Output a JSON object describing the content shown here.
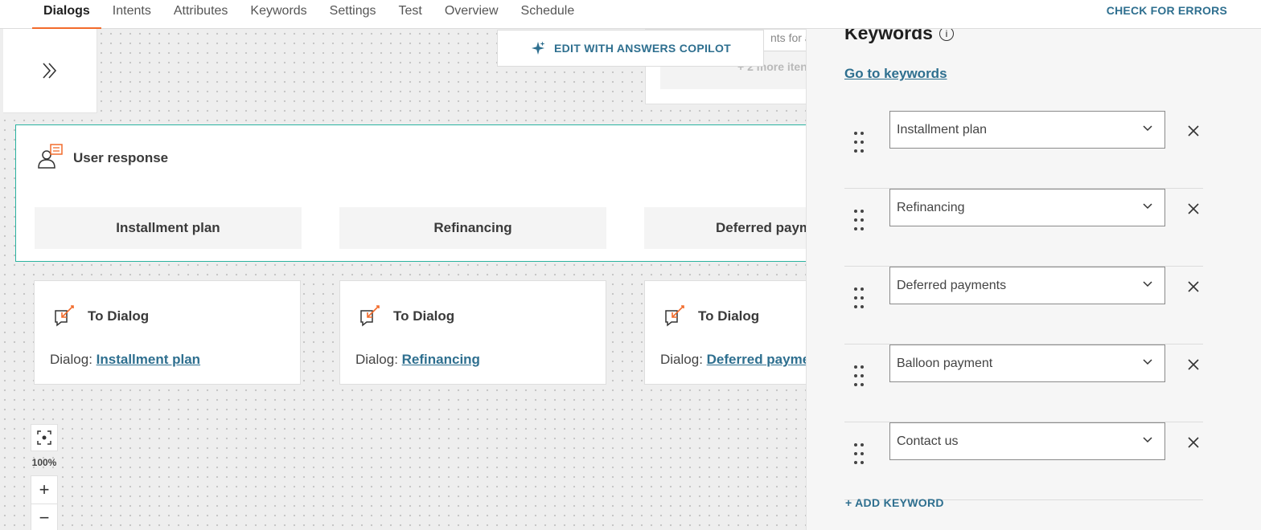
{
  "nav": {
    "tabs": [
      {
        "label": "Dialogs",
        "active": true
      },
      {
        "label": "Intents"
      },
      {
        "label": "Attributes"
      },
      {
        "label": "Keywords"
      },
      {
        "label": "Settings"
      },
      {
        "label": "Test"
      },
      {
        "label": "Overview"
      },
      {
        "label": "Schedule"
      }
    ],
    "check_errors": "CHECK FOR ERRORS"
  },
  "copilot": {
    "label": "EDIT WITH ANSWERS COPILOT",
    "icon": "sparkle-icon"
  },
  "partial_card": {
    "snippet": "nts for a",
    "more_items": "+ 2 more iten"
  },
  "user_response": {
    "title": "User response",
    "options": [
      "Installment plan",
      "Refinancing",
      "Deferred paym"
    ]
  },
  "to_dialog_cards": [
    {
      "title": "To Dialog",
      "prefix": "Dialog:",
      "link": "Installment plan"
    },
    {
      "title": "To Dialog",
      "prefix": "Dialog:",
      "link": "Refinancing"
    },
    {
      "title": "To Dialog",
      "prefix": "Dialog:",
      "link": "Deferred payme"
    }
  ],
  "zoom": {
    "level": "100%",
    "plus": "+",
    "minus": "−"
  },
  "keywords_panel": {
    "title": "Keywords",
    "goto_link": "Go to keywords",
    "keywords": [
      "Installment plan",
      "Refinancing",
      "Deferred payments",
      "Balloon payment",
      "Contact us"
    ],
    "add_keyword": "+ ADD KEYWORD"
  },
  "colors": {
    "accent": "#f26b2b",
    "link": "#2e6f8f",
    "node_border": "#2bb3a0"
  }
}
